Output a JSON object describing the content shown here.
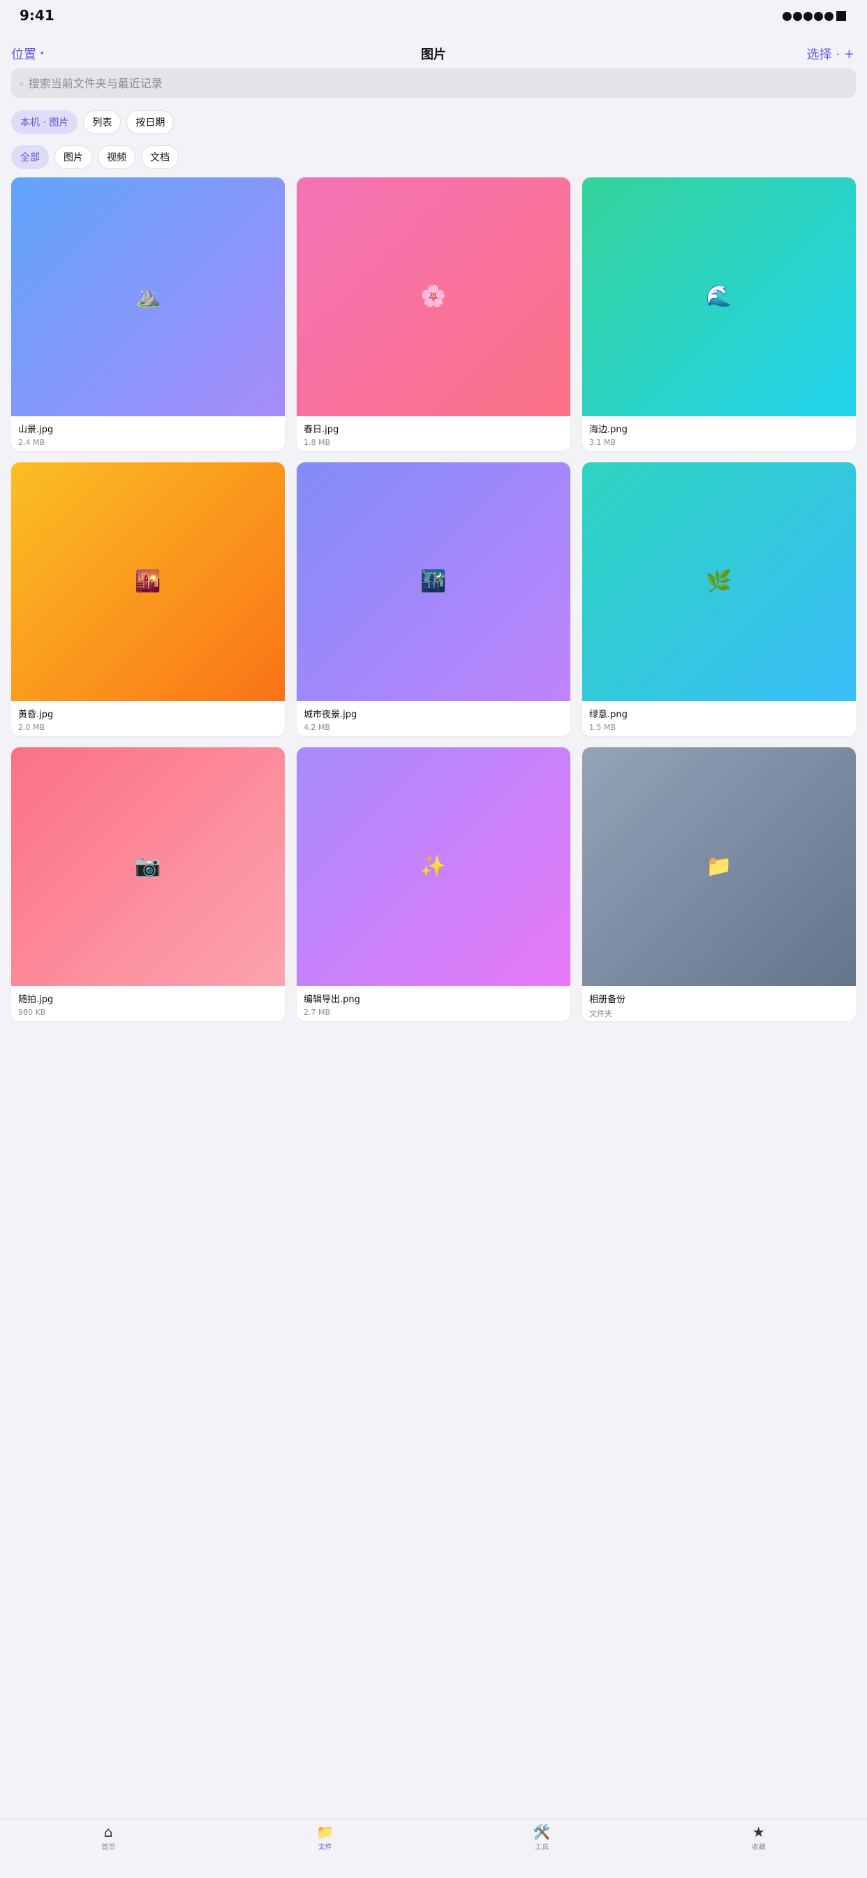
{
  "status": {
    "time": "9:41"
  },
  "nav": {
    "location_label": "位置",
    "title": "图片",
    "select_label": "选择 ·",
    "add_label": "+"
  },
  "search": {
    "placeholder": "搜索当前文件夹与最近记录"
  },
  "scope_chips": [
    {
      "label": "本机 · 图片",
      "active": true
    },
    {
      "label": "列表",
      "active": false
    },
    {
      "label": "按日期",
      "active": false
    }
  ],
  "filter_chips": [
    {
      "label": "全部",
      "active": true
    },
    {
      "label": "图片",
      "active": false
    },
    {
      "label": "视频",
      "active": false
    },
    {
      "label": "文档",
      "active": false
    }
  ],
  "files": [
    {
      "name": "山景.jpg",
      "meta": "2.4 MB",
      "icon": "⛰️",
      "icon_name": "mountain-icon",
      "colors": [
        "#60a5fa",
        "#a78bfa"
      ]
    },
    {
      "name": "春日.jpg",
      "meta": "1.8 MB",
      "icon": "🌸",
      "icon_name": "blossom-icon",
      "colors": [
        "#f472b6",
        "#fb7185"
      ]
    },
    {
      "name": "海边.png",
      "meta": "3.1 MB",
      "icon": "🌊",
      "icon_name": "wave-icon",
      "colors": [
        "#34d399",
        "#22d3ee"
      ]
    },
    {
      "name": "黄昏.jpg",
      "meta": "2.0 MB",
      "icon": "🌇",
      "icon_name": "sunset-icon",
      "colors": [
        "#fbbf24",
        "#f97316"
      ]
    },
    {
      "name": "城市夜景.jpg",
      "meta": "4.2 MB",
      "icon": "🌃",
      "icon_name": "night-city-icon",
      "colors": [
        "#818cf8",
        "#c084fc"
      ]
    },
    {
      "name": "绿意.png",
      "meta": "1.5 MB",
      "icon": "🌿",
      "icon_name": "herb-icon",
      "colors": [
        "#2dd4bf",
        "#38bdf8"
      ]
    },
    {
      "name": "随拍.jpg",
      "meta": "980 KB",
      "icon": "📷",
      "icon_name": "camera-icon",
      "colors": [
        "#fb7185",
        "#fda4af"
      ]
    },
    {
      "name": "编辑导出.png",
      "meta": "2.7 MB",
      "icon": "✨",
      "icon_name": "sparkles-icon",
      "colors": [
        "#a78bfa",
        "#e879f9"
      ]
    },
    {
      "name": "相册备份",
      "meta": "文件夹",
      "icon": "📁",
      "icon_name": "folder-icon",
      "colors": [
        "#94a3b8",
        "#64748b"
      ]
    }
  ],
  "tabs": [
    {
      "label": "首页",
      "icon": "⌂",
      "icon_name": "home-icon",
      "active": false
    },
    {
      "label": "文件",
      "icon": "📁",
      "icon_name": "folder-icon",
      "active": true
    },
    {
      "label": "工具",
      "icon": "🛠️",
      "icon_name": "tools-icon",
      "active": false
    },
    {
      "label": "收藏",
      "icon": "★",
      "icon_name": "star-icon",
      "active": false
    }
  ],
  "colors": {
    "accent": "#5b5bd6",
    "background": "#f2f2f7"
  }
}
